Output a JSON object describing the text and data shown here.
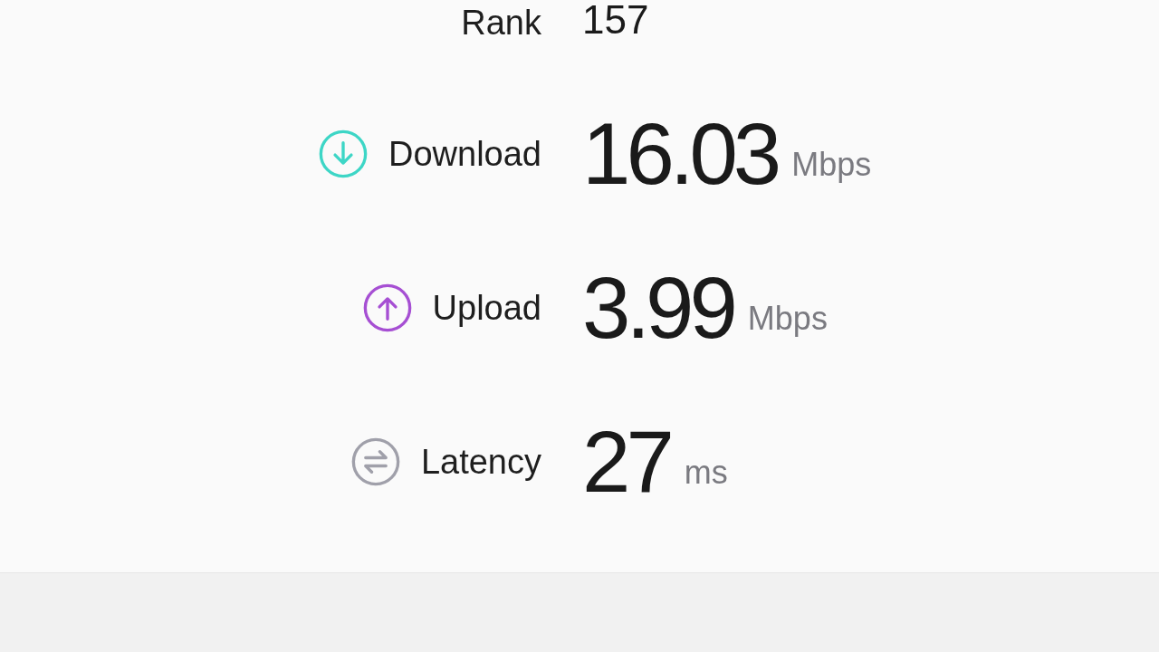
{
  "metrics": [
    {
      "kind": "rank",
      "label": "Rank",
      "value": "157"
    },
    {
      "kind": "download",
      "label": "Download",
      "value": "16.03",
      "unit": "Mbps"
    },
    {
      "kind": "upload",
      "label": "Upload",
      "value": "3.99",
      "unit": "Mbps"
    },
    {
      "kind": "latency",
      "label": "Latency",
      "value": "27",
      "unit": "ms"
    }
  ]
}
